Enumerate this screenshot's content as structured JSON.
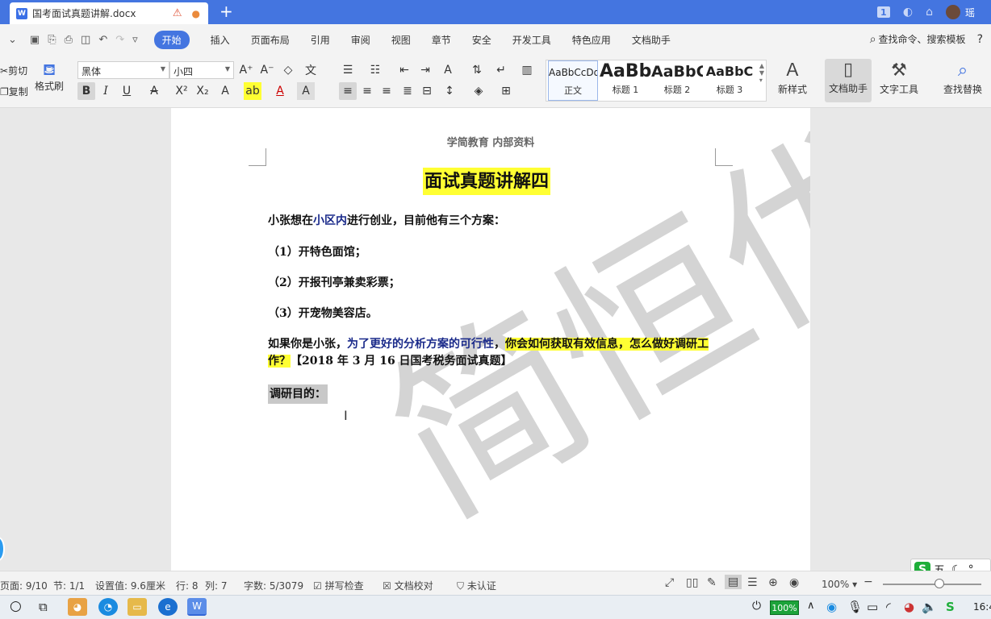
{
  "titlebar": {
    "doc_tab_title": "国考面试真题讲解.docx",
    "tab_badge": "1",
    "user_name": "瑶"
  },
  "menu": {
    "items": [
      "开始",
      "插入",
      "页面布局",
      "引用",
      "审阅",
      "视图",
      "章节",
      "安全",
      "开发工具",
      "特色应用",
      "文档助手"
    ],
    "active": "开始",
    "search_placeholder": "查找命令、搜索模板"
  },
  "ribbon": {
    "cut": "剪切",
    "copy": "复制",
    "format_painter": "格式刷",
    "font_name": "黑体",
    "font_size": "小四",
    "styles": [
      {
        "preview": "AaBbCcDd",
        "label": "正文"
      },
      {
        "preview": "AaBb",
        "label": "标题 1"
      },
      {
        "preview": "AaBbC",
        "label": "标题 2"
      },
      {
        "preview": "AaBbC",
        "label": "标题 3"
      }
    ],
    "new_style": "新样式",
    "doc_assistant": "文档助手",
    "text_tools": "文字工具",
    "find_replace": "查找替换"
  },
  "document": {
    "header": "学简教育 内部资料",
    "title": "面试真题讲解四",
    "p1_a": "小张想在",
    "p1_b": "小区内",
    "p1_c": "进行创业，目前他有三个方案：",
    "opt1": "（1）开特色面馆；",
    "opt2": "（2）开报刊亭兼卖彩票；",
    "opt3": "（3）开宠物美容店。",
    "q_a": "如果你是小张，",
    "q_b": "为了更好的分析方案的可行性",
    "q_c": "，",
    "q_d": "你会如何获取有效信息，怎么做好调研工作？",
    "q_e": "【2018 年 3 月 16 日国考税务面试真题】",
    "section": "调研目的：",
    "watermark": "简恒优"
  },
  "status": {
    "page": "页面: 9/10",
    "section": "节: 1/1",
    "setting": "设置值: 9.6厘米",
    "row": "行: 8",
    "col": "列: 7",
    "words": "字数: 5/3079",
    "spell": "拼写检查",
    "proof": "文档校对",
    "cert": "未认证",
    "zoom": "100%"
  },
  "ime": {
    "mode": "五",
    "logo": "S"
  },
  "taskbar": {
    "battery": "100%",
    "clock": "16:4"
  }
}
